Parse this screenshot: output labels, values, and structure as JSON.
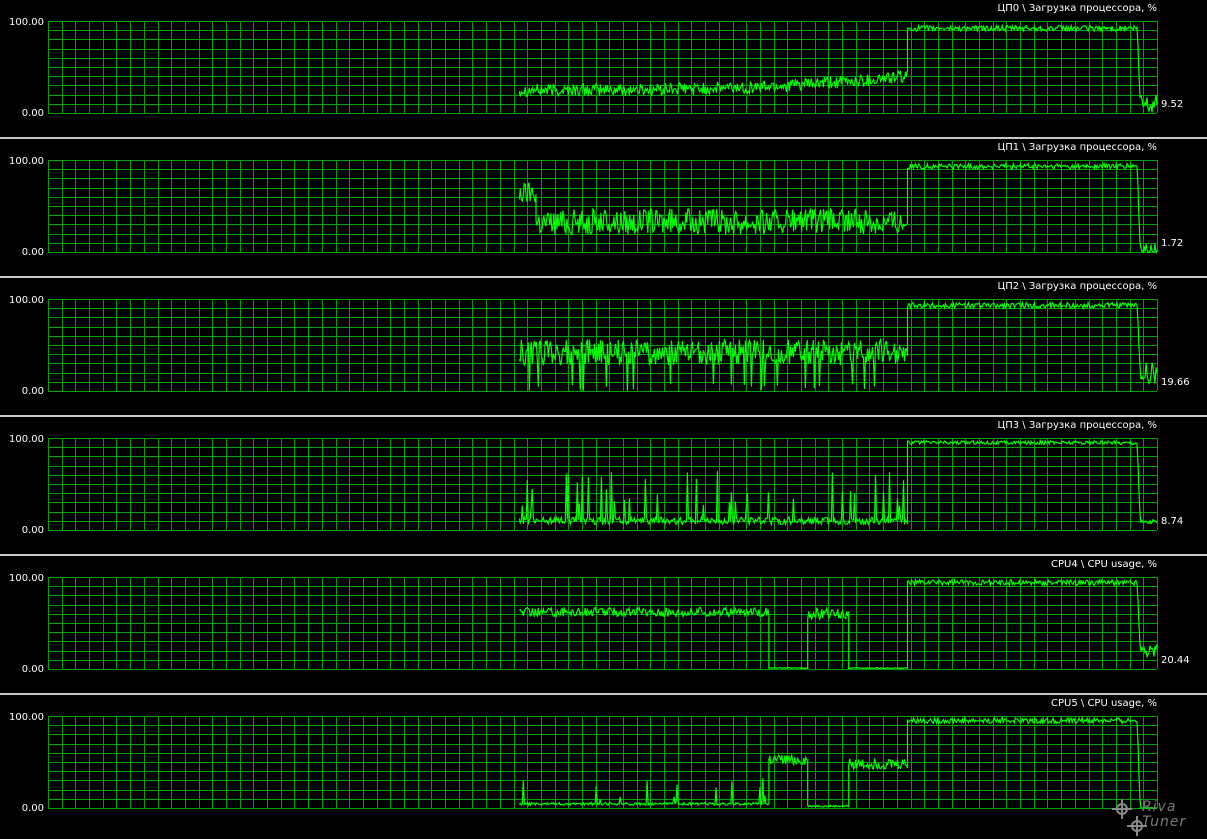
{
  "app": {
    "name": "RivaTuner"
  },
  "panels": [
    {
      "title": "ЦП0 \\ Загрузка процессора, %",
      "ymax": "100.00",
      "ymin": "0.00",
      "current": "9.52"
    },
    {
      "title": "ЦП1 \\ Загрузка процессора, %",
      "ymax": "100.00",
      "ymin": "0.00",
      "current": "1.72"
    },
    {
      "title": "ЦП2 \\ Загрузка процессора, %",
      "ymax": "100.00",
      "ymin": "0.00",
      "current": "19.66"
    },
    {
      "title": "ЦП3 \\ Загрузка процессора, %",
      "ymax": "100.00",
      "ymin": "0.00",
      "current": "8.74"
    },
    {
      "title": "CPU4 \\ CPU usage, %",
      "ymax": "100.00",
      "ymin": "0.00",
      "current": "20.44"
    },
    {
      "title": "CPU5 \\ CPU usage, %",
      "ymax": "100.00",
      "ymin": "0.00",
      "current": ""
    }
  ],
  "colors": {
    "grid": "#00a000",
    "line": "#00ff00",
    "separator": "#c8c8c8",
    "background": "#000000"
  },
  "chart_data": [
    {
      "type": "line",
      "title": "ЦП0 \\ Загрузка процессора, %",
      "ylim": [
        0,
        100
      ],
      "grid": true,
      "series": [
        {
          "segments": [
            {
              "t0": 0.425,
              "t1": 0.775,
              "base": 25,
              "jitter": 7,
              "pattern": "noise",
              "rise_to": 40
            },
            {
              "t0": 0.775,
              "t1": 0.982,
              "base": 92,
              "jitter": 3,
              "pattern": "noise"
            },
            {
              "t0": 0.982,
              "t1": 1.0,
              "base": 9.52,
              "jitter": 25,
              "pattern": "drop"
            }
          ]
        }
      ]
    },
    {
      "type": "line",
      "title": "ЦП1 \\ Загрузка процессора, %",
      "ylim": [
        0,
        100
      ],
      "grid": true,
      "series": [
        {
          "segments": [
            {
              "t0": 0.425,
              "t1": 0.44,
              "base": 65,
              "jitter": 12,
              "pattern": "noise"
            },
            {
              "t0": 0.44,
              "t1": 0.775,
              "base": 33,
              "jitter": 14,
              "pattern": "noise"
            },
            {
              "t0": 0.775,
              "t1": 0.982,
              "base": 93,
              "jitter": 3,
              "pattern": "noise"
            },
            {
              "t0": 0.982,
              "t1": 1.0,
              "base": 1.72,
              "jitter": 15,
              "pattern": "drop"
            }
          ]
        }
      ]
    },
    {
      "type": "line",
      "title": "ЦП2 \\ Загрузка процессора, %",
      "ylim": [
        0,
        100
      ],
      "grid": true,
      "series": [
        {
          "segments": [
            {
              "t0": 0.425,
              "t1": 0.775,
              "base": 42,
              "jitter": 14,
              "pattern": "dips"
            },
            {
              "t0": 0.775,
              "t1": 0.982,
              "base": 93,
              "jitter": 3,
              "pattern": "noise"
            },
            {
              "t0": 0.982,
              "t1": 1.0,
              "base": 19.66,
              "jitter": 25,
              "pattern": "drop"
            }
          ]
        }
      ]
    },
    {
      "type": "line",
      "title": "ЦП3 \\ Загрузка процессора, %",
      "ylim": [
        0,
        100
      ],
      "grid": true,
      "series": [
        {
          "segments": [
            {
              "t0": 0.425,
              "t1": 0.775,
              "base": 10,
              "jitter": 8,
              "pattern": "spikes"
            },
            {
              "t0": 0.775,
              "t1": 0.982,
              "base": 95,
              "jitter": 2,
              "pattern": "noise"
            },
            {
              "t0": 0.982,
              "t1": 1.0,
              "base": 8.74,
              "jitter": 5,
              "pattern": "drop"
            }
          ]
        }
      ]
    },
    {
      "type": "line",
      "title": "CPU4 \\ CPU usage, %",
      "ylim": [
        0,
        100
      ],
      "grid": true,
      "series": [
        {
          "segments": [
            {
              "t0": 0.425,
              "t1": 0.65,
              "base": 62,
              "jitter": 5,
              "pattern": "noise"
            },
            {
              "t0": 0.65,
              "t1": 0.685,
              "base": 1,
              "jitter": 1,
              "pattern": "flat"
            },
            {
              "t0": 0.685,
              "t1": 0.722,
              "base": 60,
              "jitter": 6,
              "pattern": "noise"
            },
            {
              "t0": 0.722,
              "t1": 0.775,
              "base": 1,
              "jitter": 1,
              "pattern": "flat"
            },
            {
              "t0": 0.775,
              "t1": 0.982,
              "base": 94,
              "jitter": 3,
              "pattern": "noise"
            },
            {
              "t0": 0.982,
              "t1": 1.0,
              "base": 20.44,
              "jitter": 15,
              "pattern": "drop"
            }
          ]
        }
      ]
    },
    {
      "type": "line",
      "title": "CPU5 \\ CPU usage, %",
      "ylim": [
        0,
        100
      ],
      "grid": true,
      "series": [
        {
          "segments": [
            {
              "t0": 0.425,
              "t1": 0.65,
              "base": 3,
              "jitter": 3,
              "pattern": "spikes_small"
            },
            {
              "t0": 0.65,
              "t1": 0.685,
              "base": 52,
              "jitter": 6,
              "pattern": "noise"
            },
            {
              "t0": 0.685,
              "t1": 0.722,
              "base": 2,
              "jitter": 2,
              "pattern": "flat"
            },
            {
              "t0": 0.722,
              "t1": 0.775,
              "base": 48,
              "jitter": 6,
              "pattern": "noise"
            },
            {
              "t0": 0.775,
              "t1": 0.982,
              "base": 95,
              "jitter": 3,
              "pattern": "noise"
            },
            {
              "t0": 0.982,
              "t1": 1.0,
              "base": 0,
              "jitter": 1,
              "pattern": "drop"
            }
          ]
        }
      ]
    }
  ]
}
